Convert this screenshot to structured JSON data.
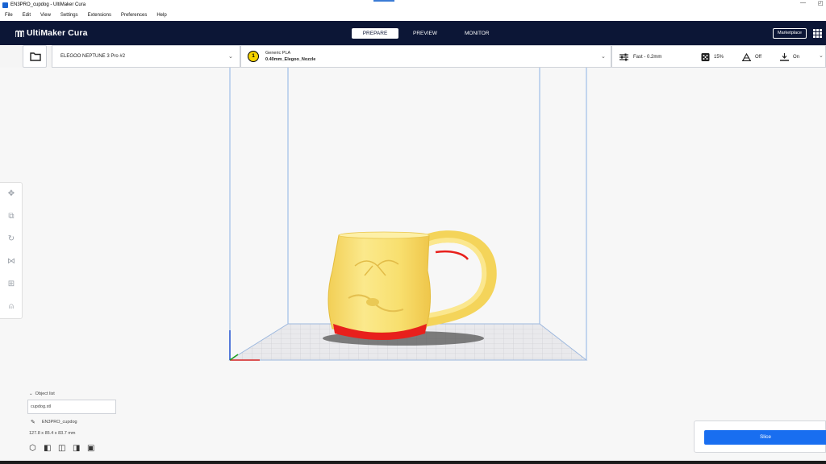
{
  "window": {
    "title": "EN3PRO_cupdog - UltiMaker Cura",
    "minimize": "—",
    "restore": "◰"
  },
  "menu": [
    "File",
    "Edit",
    "View",
    "Settings",
    "Extensions",
    "Preferences",
    "Help"
  ],
  "header": {
    "app_name": "UltiMaker Cura",
    "tabs": [
      {
        "label": "PREPARE",
        "active": true
      },
      {
        "label": "PREVIEW",
        "active": false
      },
      {
        "label": "MONITOR",
        "active": false
      }
    ],
    "marketplace": "Marketplace"
  },
  "toolbar": {
    "printer": "ELEGOO NEPTUNE 3 Pro #2",
    "extruder_number": "1",
    "material": "Generic PLA",
    "nozzle": "0.40mm_Elegoo_Nozzle",
    "profile": "Fast - 0.2mm",
    "infill": "15%",
    "support": "Off",
    "adhesion": "On"
  },
  "object_list": {
    "label": "Object list",
    "file": "cupdog.stl",
    "name": "EN3PRO_cupdog",
    "dimensions": "127.8 x 85.4 x 83.7 mm"
  },
  "slice": {
    "label": "Slice"
  },
  "colors": {
    "header_bg": "#0c1636",
    "accent_blue": "#196ef0",
    "model_yellow": "#f8e27a",
    "overhang_red": "#e8201c"
  }
}
